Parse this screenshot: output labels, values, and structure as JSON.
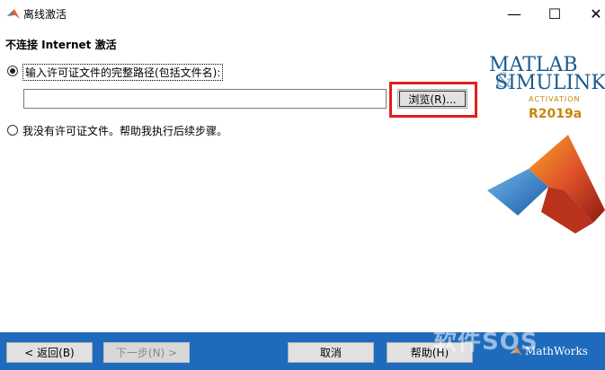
{
  "window": {
    "title": "离线激活",
    "minimize_glyph": "—",
    "maximize_glyph": "☐",
    "close_glyph": "✕"
  },
  "heading": "不连接 Internet 激活",
  "options": {
    "license_file_label": "输入许可证文件的完整路径(包括文件名):",
    "license_file_selected": true,
    "no_license_label": "我没有许可证文件。帮助我执行后续步骤。",
    "no_license_selected": false
  },
  "path_input": {
    "value": "",
    "placeholder": ""
  },
  "browse_button": "浏览(R)...",
  "logo": {
    "line1": "MATLAB",
    "line2": "SIMULINK",
    "ampersand": "&",
    "subtitle": "ACTIVATION",
    "release": "R2019a"
  },
  "footer": {
    "back": "< 返回(B)",
    "next": "下一步(N) >",
    "cancel": "取消",
    "help": "帮助(H)",
    "brand": "MathWorks",
    "watermark": "软件SOS"
  },
  "colors": {
    "footer_bg": "#1e6bbd",
    "highlight_border": "#e01e1e",
    "logo_blue": "#1a5a8e",
    "logo_orange": "#c8860c"
  },
  "icons": [
    "matlab-icon",
    "minimize-icon",
    "maximize-icon",
    "close-icon",
    "membrane-logo",
    "mathworks-icon"
  ]
}
